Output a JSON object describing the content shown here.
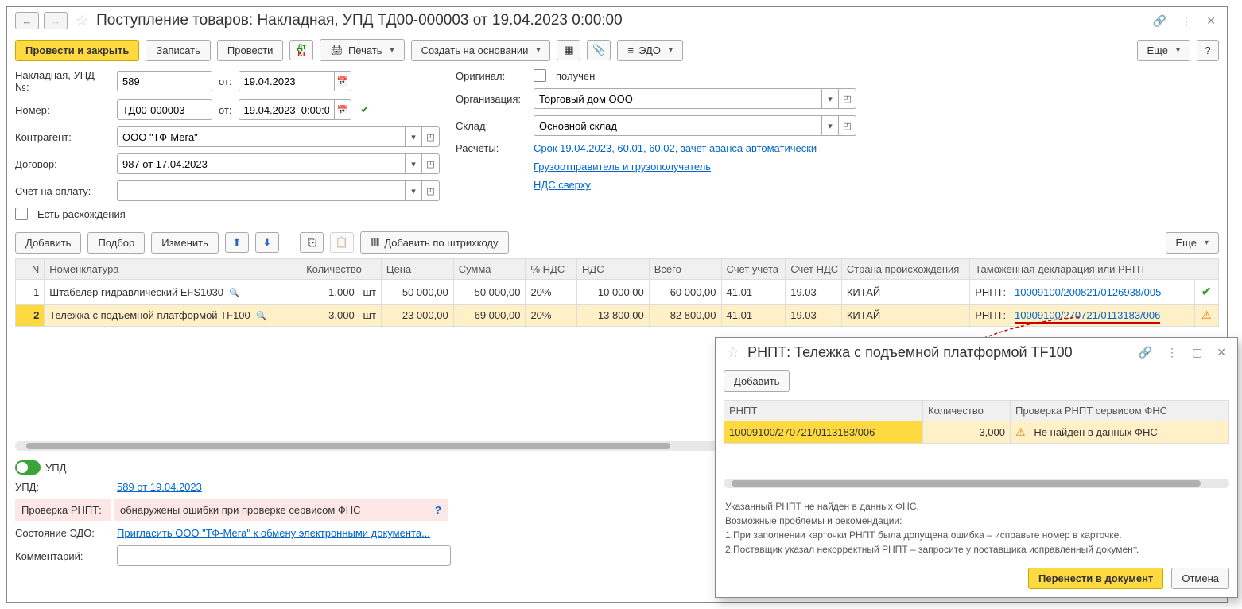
{
  "title": "Поступление товаров: Накладная, УПД ТД00-000003 от 19.04.2023 0:00:00",
  "toolbar": {
    "post_close": "Провести и закрыть",
    "save": "Записать",
    "post": "Провести",
    "print": "Печать",
    "create_based": "Создать на основании",
    "edo": "ЭДО",
    "more": "Еще",
    "help": "?"
  },
  "fields": {
    "invoice_label": "Накладная, УПД №:",
    "invoice_no": "589",
    "from": "от:",
    "invoice_date": "19.04.2023",
    "number_label": "Номер:",
    "number": "ТД00-000003",
    "number_date": "19.04.2023  0:00:00",
    "counterparty_label": "Контрагент:",
    "counterparty": "ООО \"ТФ-Мега\"",
    "contract_label": "Договор:",
    "contract": "987 от 17.04.2023",
    "payinv_label": "Счет на оплату:",
    "discrep_label": "Есть расхождения",
    "original_label": "Оригинал:",
    "received_label": "получен",
    "org_label": "Организация:",
    "org": "Торговый дом ООО",
    "warehouse_label": "Склад:",
    "warehouse": "Основной склад",
    "calc_label": "Расчеты:",
    "calc_link": "Срок 19.04.2023, 60.01, 60.02, зачет аванса автоматически",
    "shipper_link": "Грузоотправитель и грузополучатель",
    "vat_link": "НДС сверху"
  },
  "table_toolbar": {
    "add": "Добавить",
    "pick": "Подбор",
    "edit": "Изменить",
    "barcode": "Добавить по штрихкоду"
  },
  "columns": {
    "n": "N",
    "nomen": "Номенклатура",
    "qty": "Количество",
    "price": "Цена",
    "sum": "Сумма",
    "vat_pct": "% НДС",
    "vat": "НДС",
    "total": "Всего",
    "acc": "Счет учета",
    "vat_acc": "Счет НДС",
    "country": "Страна происхождения",
    "customs": "Таможенная декларация или РНПТ"
  },
  "rows": [
    {
      "n": "1",
      "name": "Штабелер гидравлический EFS1030",
      "qty": "1,000",
      "unit": "шт",
      "price": "50 000,00",
      "sum": "50 000,00",
      "vat_pct": "20%",
      "vat": "10 000,00",
      "total": "60 000,00",
      "acc": "41.01",
      "vat_acc": "19.03",
      "country": "КИТАЙ",
      "rnpt_lbl": "РНПТ:",
      "rnpt": "10009100/200821/0126938/005",
      "status": "ok"
    },
    {
      "n": "2",
      "name": "Тележка с подъемной платформой TF100",
      "qty": "3,000",
      "unit": "шт",
      "price": "23 000,00",
      "sum": "69 000,00",
      "vat_pct": "20%",
      "vat": "13 800,00",
      "total": "82 800,00",
      "acc": "41.01",
      "vat_acc": "19.03",
      "country": "КИТАЙ",
      "rnpt_lbl": "РНПТ:",
      "rnpt": "10009100/270721/0113183/006",
      "status": "warn"
    }
  ],
  "footer": {
    "upd_toggle": "УПД",
    "upd_label": "УПД:",
    "upd_link": "589 от 19.04.2023",
    "check_label": "Проверка РНПТ:",
    "check_msg": "обнаружены ошибки при проверке сервисом ФНС",
    "edo_state_label": "Состояние ЭДО:",
    "edo_state_link": "Пригласить ООО \"ТФ-Мега\" к обмену электронными документа...",
    "comment_label": "Комментарий:"
  },
  "popup": {
    "title": "РНПТ: Тележка с подъемной платформой TF100",
    "add": "Добавить",
    "col_rnpt": "РНПТ",
    "col_qty": "Количество",
    "col_check": "Проверка РНПТ сервисом ФНС",
    "row_rnpt": "10009100/270721/0113183/006",
    "row_qty": "3,000",
    "row_status": "Не найден в данных ФНС",
    "note1": "Указанный РНПТ не найден в данных ФНС.",
    "note2": "Возможные проблемы и рекомендации:",
    "note3": "1.При заполнении карточки РНПТ была допущена ошибка – исправьте номер в карточке.",
    "note4": "2.Поставщик указал некорректный РНПТ – запросите у поставщика исправленный документ.",
    "transfer": "Перенести в документ",
    "cancel": "Отмена"
  }
}
